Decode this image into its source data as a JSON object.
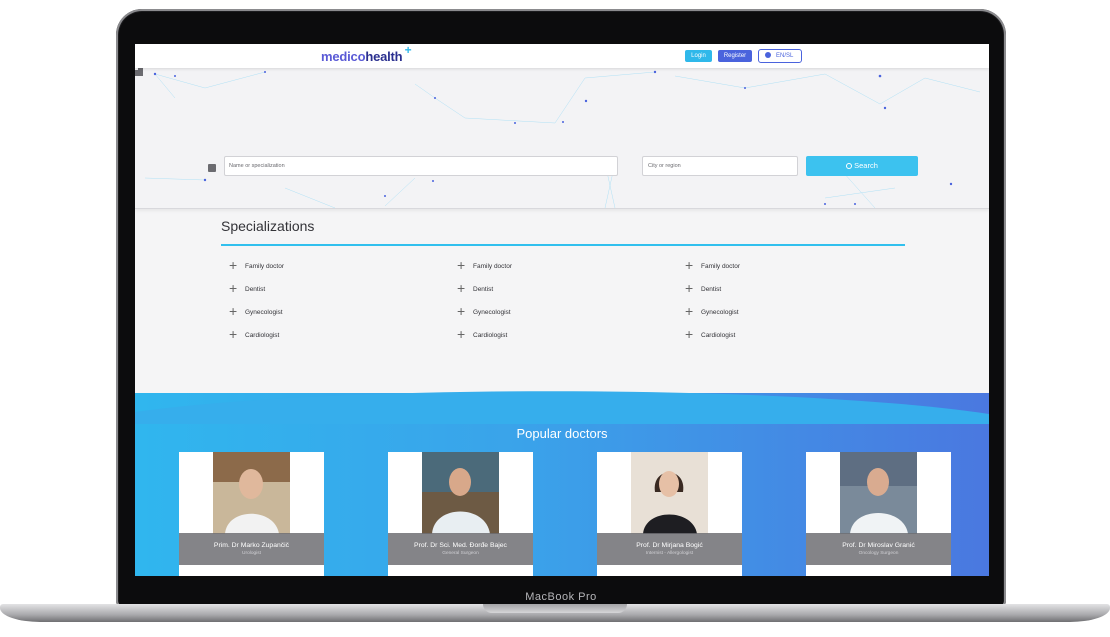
{
  "device": {
    "label": "MacBook Pro"
  },
  "header": {
    "logo_part1": "medico",
    "logo_part2": "health",
    "logo_plus": "+",
    "login_label": "Login",
    "register_label": "Register",
    "language_label": "EN/SL"
  },
  "search": {
    "name_placeholder": "Name or specialization",
    "city_placeholder": "City or region",
    "search_button": "Search"
  },
  "specializations": {
    "title": "Specializations",
    "columns": [
      [
        "Family doctor",
        "Dentist",
        "Gynecologist",
        "Cardiologist"
      ],
      [
        "Family doctor",
        "Dentist",
        "Gynecologist",
        "Cardiologist"
      ],
      [
        "Family doctor",
        "Dentist",
        "Gynecologist",
        "Cardiologist"
      ]
    ]
  },
  "popular": {
    "title": "Popular doctors",
    "doctors": [
      {
        "name": "Prim. Dr Marko Zupančič",
        "specialty": "Urologist"
      },
      {
        "name": "Prof. Dr Sci. Med. Đorđe Bajec",
        "specialty": "General Surgeon"
      },
      {
        "name": "Prof. Dr Mirjana Bogić",
        "specialty": "Internist - Allergologist"
      },
      {
        "name": "Prof. Dr Miroslav Granić",
        "specialty": "Oncology Surgeon"
      }
    ]
  },
  "colors": {
    "accent_cyan": "#31c0ee",
    "accent_indigo": "#4a63dd"
  }
}
